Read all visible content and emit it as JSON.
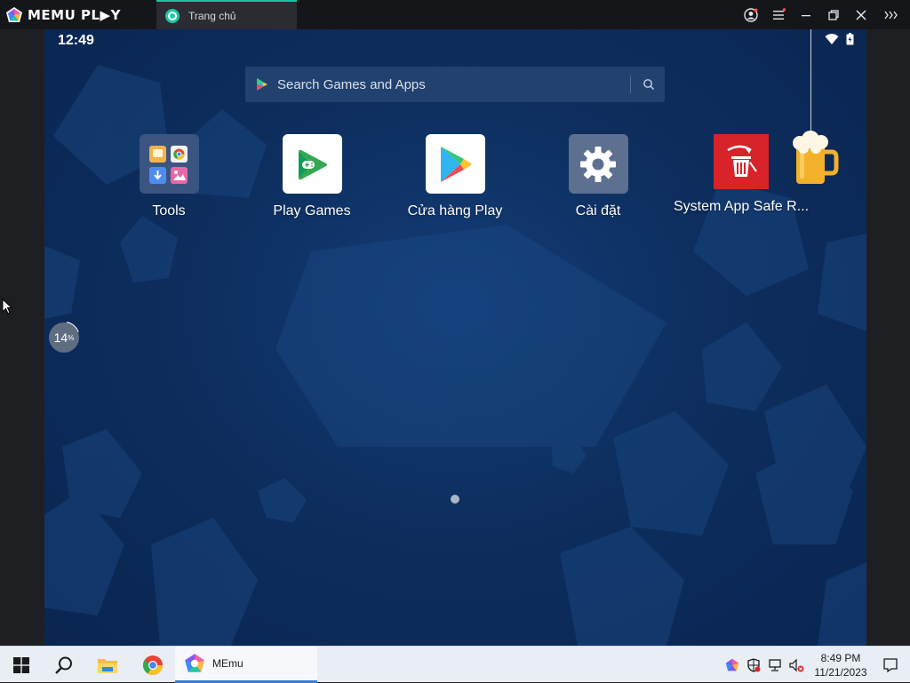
{
  "titlebar": {
    "logo_text": "MEMU PL▶Y",
    "tab_label": "Trang chủ",
    "buttons": [
      "account-icon",
      "menu-icon",
      "minimize-icon",
      "restore-icon",
      "close-icon",
      "expand-sidebar-icon"
    ]
  },
  "android": {
    "clock": "12:49",
    "search_placeholder": "Search Games and Apps",
    "apps": [
      {
        "label": "Tools",
        "icon": "tools-folder-icon"
      },
      {
        "label": "Play Games",
        "icon": "play-games-icon"
      },
      {
        "label": "Cửa hàng Play",
        "icon": "play-store-icon"
      },
      {
        "label": "Cài đặt",
        "icon": "settings-gear-icon"
      },
      {
        "label": "System App Safe R...",
        "icon": "trash-icon"
      }
    ],
    "progress": {
      "value": "14",
      "unit": "%"
    },
    "page_indicator": {
      "current": 1,
      "total": 1
    }
  },
  "taskbar": {
    "app_label": "MEmu",
    "time": "8:49 PM",
    "date": "11/21/2023"
  },
  "colors": {
    "accent_teal": "#1fc7a6",
    "screen_bg": "#0d2e5e",
    "taskbar_bg": "#e9eef5"
  }
}
